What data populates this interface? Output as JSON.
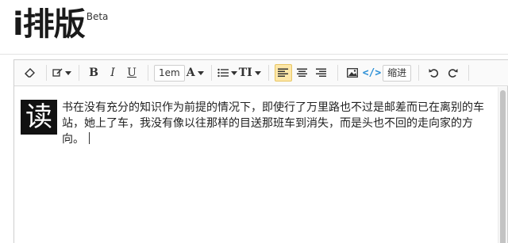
{
  "header": {
    "logo_text": "i排版",
    "logo_badge": "Beta"
  },
  "toolbar": {
    "eraser_icon": "eraser-icon",
    "brush_icon": "brush-icon",
    "bold": "B",
    "italic": "I",
    "underline": "U",
    "font_size": "1em",
    "font_color": "A",
    "list_icon": "list-icon",
    "text_size": "TI",
    "align_left_icon": "align-left-icon",
    "align_center_icon": "align-center-icon",
    "align_right_icon": "align-right-icon",
    "image_icon": "image-icon",
    "code": "</>",
    "indent": "缩进",
    "undo_icon": "undo-icon",
    "redo_icon": "redo-icon"
  },
  "editor": {
    "dropcap": "读",
    "body": "书在没有充分的知识作为前提的情况下，即使行了万里路也不过是邮差而已在离别的车站，她上了车，我没有像以往那样的目送那班车到消失，而是头也不回的走向家的方向。"
  },
  "colors": {
    "active_bg": "#fde7a8",
    "code_blue": "#2b8fd6",
    "dropcap_bg": "#111111"
  }
}
